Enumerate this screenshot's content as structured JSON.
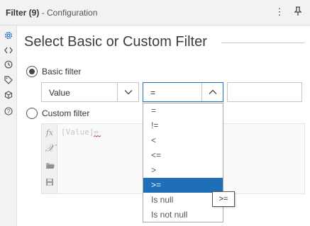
{
  "window": {
    "title": "Filter (9)",
    "subtitle": "- Configuration",
    "menu_icon": "vertical-ellipsis-icon",
    "pin_icon": "pin-icon"
  },
  "rail": {
    "icons": [
      "gear-icon",
      "code-brackets-icon",
      "target-icon",
      "tag-icon",
      "cube-icon",
      "help-icon"
    ],
    "active_color": "#1e6fb8"
  },
  "main": {
    "heading": "Select Basic or Custom Filter",
    "basic_filter": {
      "label": "Basic filter",
      "selected": true,
      "field_value": "Value",
      "operator_value": "=",
      "comparison_value": ""
    },
    "custom_filter": {
      "label": "Custom filter",
      "selected": false,
      "expression": "[Value]=",
      "tools": [
        "fx-icon",
        "variable-x-icon",
        "open-folder-icon",
        "save-icon"
      ]
    }
  },
  "operator_dropdown": {
    "options": [
      "=",
      "!=",
      "<",
      "<=",
      ">",
      ">=",
      "Is null",
      "Is not null"
    ],
    "selected_index": 5,
    "selected_color": "#1e6fb8"
  },
  "tooltip": {
    "text": ">="
  }
}
